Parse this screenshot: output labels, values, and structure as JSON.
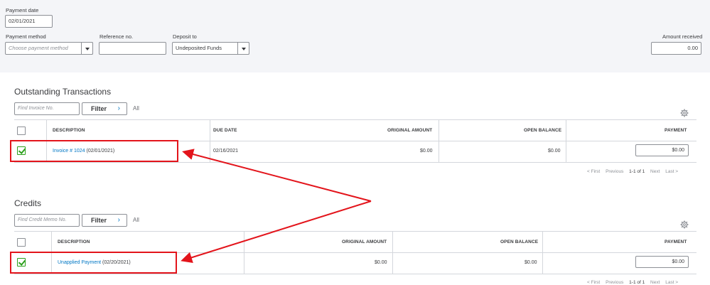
{
  "header": {
    "payment_date_label": "Payment date",
    "payment_date_value": "02/01/2021",
    "payment_method_label": "Payment method",
    "payment_method_placeholder": "Choose payment method",
    "reference_label": "Reference no.",
    "reference_value": "",
    "deposit_label": "Deposit to",
    "deposit_value": "Undeposited Funds",
    "amount_label": "Amount received",
    "amount_value": "0.00"
  },
  "outstanding": {
    "title": "Outstanding Transactions",
    "search_placeholder": "Find Invoice No.",
    "filter_label": "Filter",
    "all_label": "All",
    "columns": {
      "description": "DESCRIPTION",
      "due_date": "DUE DATE",
      "original_amount": "ORIGINAL AMOUNT",
      "open_balance": "OPEN BALANCE",
      "payment": "PAYMENT"
    },
    "rows": [
      {
        "checked": true,
        "link_text": "Invoice # 1024",
        "date_text": "(02/01/2021)",
        "due_date": "02/16/2021",
        "original_amount": "$0.00",
        "open_balance": "$0.00",
        "payment": "$0.00"
      }
    ],
    "pager": {
      "first": "< First",
      "previous": "Previous",
      "range": "1-1 of 1",
      "next": "Next",
      "last": "Last >"
    }
  },
  "credits": {
    "title": "Credits",
    "search_placeholder": "Find Credit Memo No.",
    "filter_label": "Filter",
    "all_label": "All",
    "columns": {
      "description": "DESCRIPTION",
      "original_amount": "ORIGINAL AMOUNT",
      "open_balance": "OPEN BALANCE",
      "payment": "PAYMENT"
    },
    "rows": [
      {
        "checked": true,
        "link_text": "Unapplied Payment",
        "date_text": "(02/20/2021)",
        "original_amount": "$0.00",
        "open_balance": "$0.00",
        "payment": "$0.00"
      }
    ],
    "pager": {
      "first": "< First",
      "previous": "Previous",
      "range": "1-1 of 1",
      "next": "Next",
      "last": "Last >"
    }
  },
  "colors": {
    "annotation_red": "#e3141b",
    "link_blue": "#0077c5",
    "check_green": "#2ca01c",
    "header_bg": "#f4f5f8"
  },
  "icons": [
    "caret-down-icon",
    "chevron-right-icon",
    "gear-icon",
    "checkmark-icon",
    "arrow-annotation"
  ]
}
